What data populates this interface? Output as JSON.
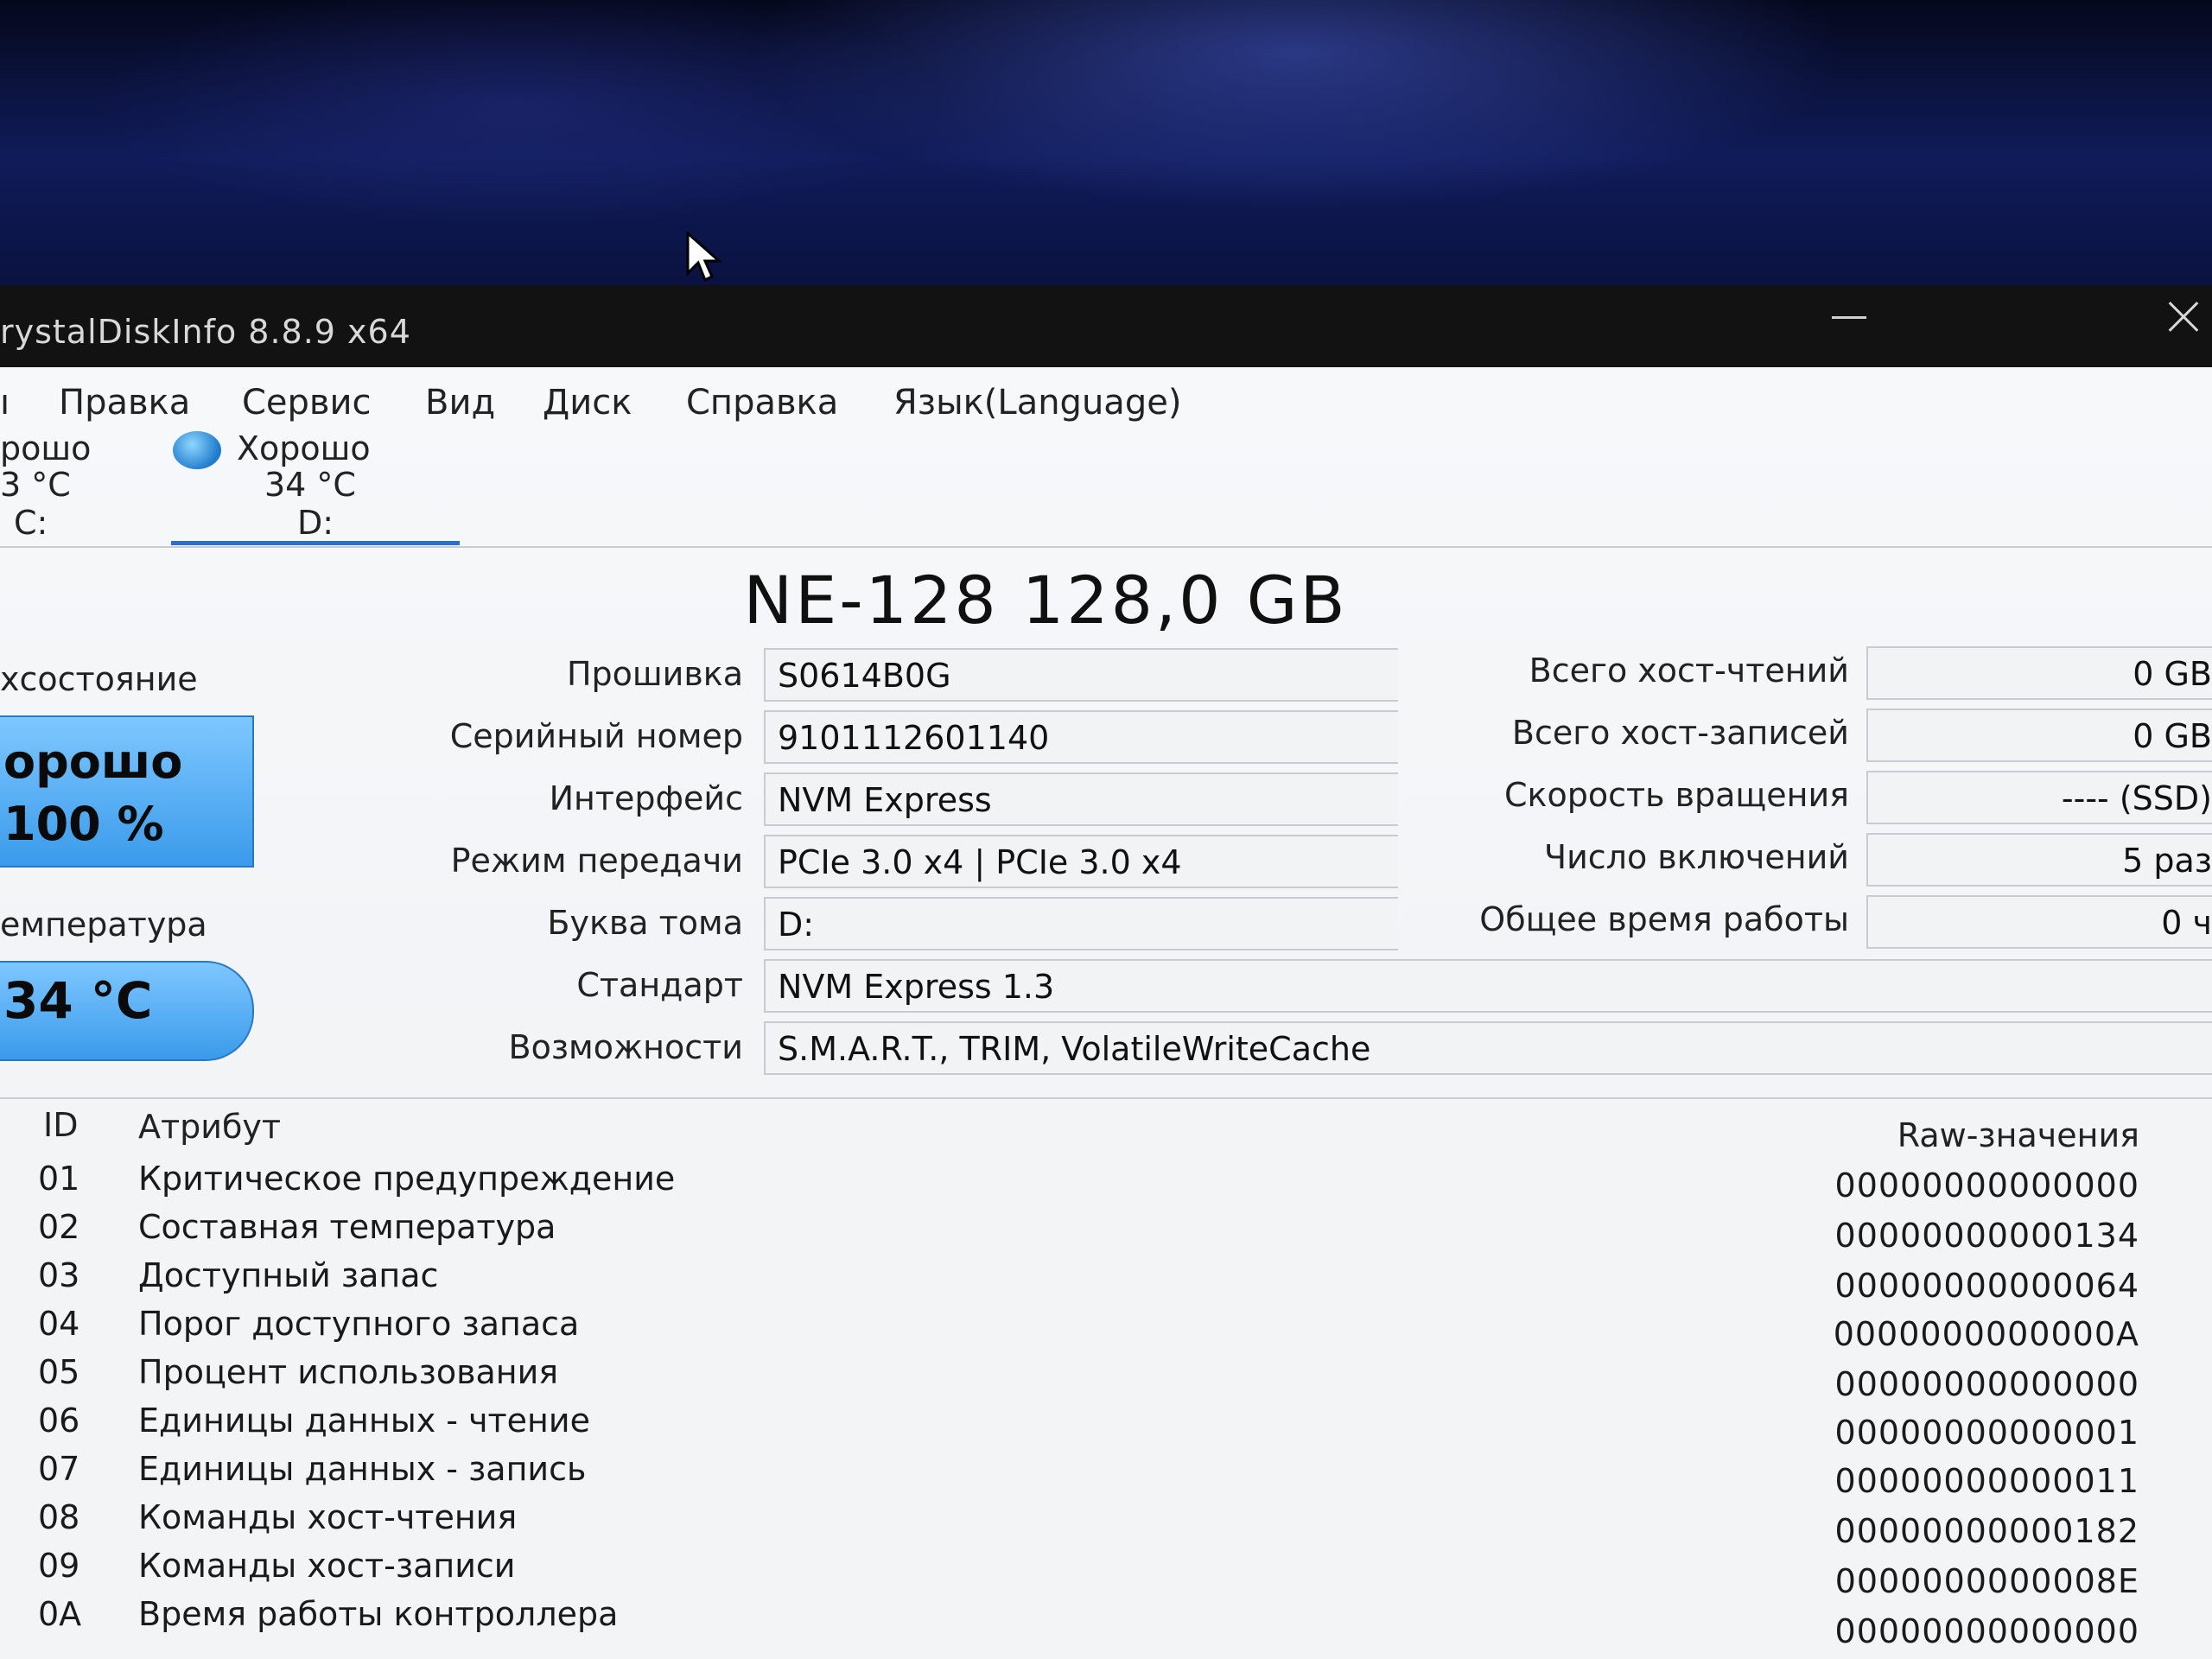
{
  "window": {
    "title": "rystalDiskInfo 8.8.9 x64"
  },
  "menu": [
    "Правка",
    "Сервис",
    "Вид",
    "Диск",
    "Справка",
    "Язык(Language)"
  ],
  "drives": [
    {
      "status": "рошо",
      "temp": "3 °C",
      "letter": "C:"
    },
    {
      "status": "Хорошо",
      "temp": "34 °C",
      "letter": "D:"
    }
  ],
  "model": "NE-128 128,0 GB",
  "health": {
    "label": "хсостояние",
    "status": "орошо",
    "percent": "100 %"
  },
  "temperature": {
    "label": "емпература",
    "value": "34 °C"
  },
  "info": [
    {
      "label": "Прошивка",
      "value": "S0614B0G"
    },
    {
      "label": "Серийный номер",
      "value": "9101112601140"
    },
    {
      "label": "Интерфейс",
      "value": "NVM Express"
    },
    {
      "label": "Режим передачи",
      "value": "PCIe 3.0 x4 | PCIe 3.0 x4"
    },
    {
      "label": "Буква тома",
      "value": "D:"
    },
    {
      "label": "Стандарт",
      "value": "NVM Express 1.3"
    },
    {
      "label": "Возможности",
      "value": "S.M.A.R.T., TRIM, VolatileWriteCache"
    }
  ],
  "stats": [
    {
      "label": "Всего хост-чтений",
      "value": "0 GB"
    },
    {
      "label": "Всего хост-записей",
      "value": "0 GB"
    },
    {
      "label": "Скорость вращения",
      "value": "---- (SSD)"
    },
    {
      "label": "Число включений",
      "value": "5 раз"
    },
    {
      "label": "Общее время работы",
      "value": "0 ч"
    }
  ],
  "table": {
    "headers": {
      "id": "ID",
      "attr": "Атрибут",
      "raw": "Raw-значения"
    },
    "rows": [
      {
        "id": "01",
        "attr": "Критическое предупреждение",
        "raw": "00000000000000"
      },
      {
        "id": "02",
        "attr": "Составная температура",
        "raw": "00000000000134"
      },
      {
        "id": "03",
        "attr": "Доступный запас",
        "raw": "00000000000064"
      },
      {
        "id": "04",
        "attr": "Порог доступного запаса",
        "raw": "0000000000000A"
      },
      {
        "id": "05",
        "attr": "Процент использования",
        "raw": "00000000000000"
      },
      {
        "id": "06",
        "attr": "Единицы данных - чтение",
        "raw": "00000000000001"
      },
      {
        "id": "07",
        "attr": "Единицы данных - запись",
        "raw": "00000000000011"
      },
      {
        "id": "08",
        "attr": "Команды хост-чтения",
        "raw": "00000000000182"
      },
      {
        "id": "09",
        "attr": "Команды хост-записи",
        "raw": "0000000000008E"
      },
      {
        "id": "0A",
        "attr": "Время работы контроллера",
        "raw": "00000000000000"
      }
    ]
  }
}
